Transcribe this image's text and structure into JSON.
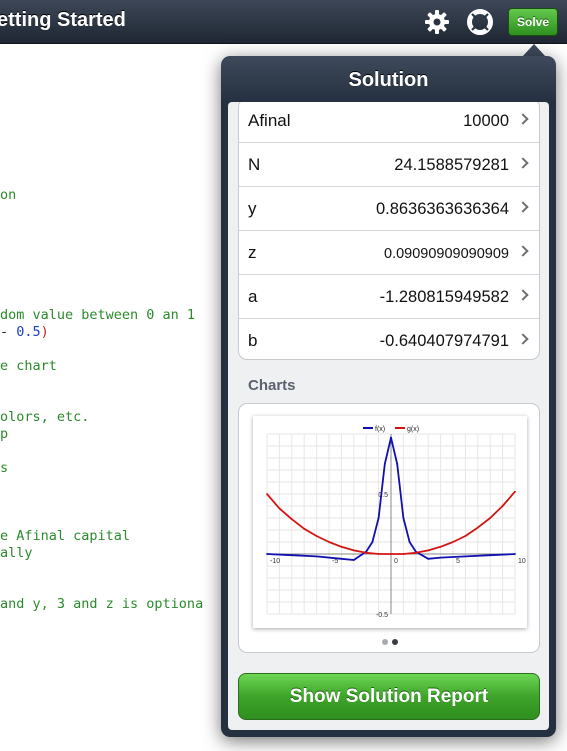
{
  "navbar": {
    "title": "etting Started",
    "solve_label": "Solve"
  },
  "code_lines": [
    {
      "text": "on"
    },
    {
      "text": "dom value between 0 an 1"
    },
    {
      "parts": [
        {
          "text": "- ",
          "cls": "dash"
        },
        {
          "text": "0.5",
          "cls": "num"
        },
        {
          "text": ")",
          "cls": "paren"
        }
      ]
    },
    {
      "text": "e chart"
    },
    {
      "text": "olors, etc."
    },
    {
      "text": "p"
    },
    {
      "text": "s"
    },
    {
      "text": "e Afinal capital"
    },
    {
      "text": "ally"
    },
    {
      "text": ""
    },
    {
      "text": "and y, 3 and z is optiona"
    }
  ],
  "popover": {
    "title": "Solution",
    "results": [
      {
        "name": "Afinal",
        "value": "10000",
        "small": false
      },
      {
        "name": "N",
        "value": "24.1588579281",
        "small": false
      },
      {
        "name": "y",
        "value": "0.8636363636364",
        "small": false
      },
      {
        "name": "z",
        "value": "0.09090909090909",
        "small": true
      },
      {
        "name": "a",
        "value": "-1.280815949582",
        "small": false
      },
      {
        "name": "b",
        "value": "-0.640407974791",
        "small": false
      }
    ],
    "charts_label": "Charts",
    "report_button": "Show Solution Report",
    "page_indicator": {
      "total": 2,
      "active": 2
    }
  },
  "chart_data": {
    "type": "line",
    "title": "",
    "xlabel": "",
    "ylabel": "",
    "xlim": [
      -10,
      10
    ],
    "ylim": [
      -0.5,
      1
    ],
    "x_ticks": [
      "-10",
      "-5",
      "0",
      "5",
      "10"
    ],
    "y_ticks": [
      "-0.5",
      "0.5"
    ],
    "grid": true,
    "legend": "top-center",
    "series": [
      {
        "name": "f(x)",
        "color": "#1010b0",
        "x": [
          -10,
          -8,
          -6,
          -4,
          -3,
          -2,
          -1.5,
          -1,
          -0.5,
          0,
          0.5,
          1,
          1.5,
          2,
          3,
          4,
          6,
          8,
          10
        ],
        "y": [
          0.0,
          -0.01,
          -0.02,
          -0.04,
          -0.05,
          0.02,
          0.1,
          0.3,
          0.75,
          0.97,
          0.75,
          0.3,
          0.1,
          0.02,
          -0.04,
          -0.03,
          -0.02,
          -0.01,
          0.0
        ]
      },
      {
        "name": "g(x)",
        "color": "#d41414",
        "x": [
          -10,
          -9,
          -8,
          -7,
          -6,
          -5,
          -4,
          -3,
          -2,
          -1,
          0,
          1,
          2,
          3,
          4,
          5,
          6,
          7,
          8,
          9,
          10
        ],
        "y": [
          0.5,
          0.38,
          0.29,
          0.21,
          0.15,
          0.1,
          0.06,
          0.03,
          0.01,
          0.0,
          0.0,
          0.0,
          0.01,
          0.03,
          0.06,
          0.1,
          0.15,
          0.22,
          0.3,
          0.4,
          0.52
        ]
      }
    ]
  }
}
